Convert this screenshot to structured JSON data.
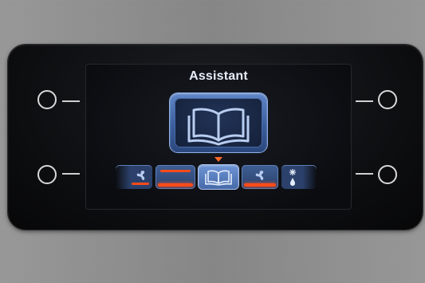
{
  "display": {
    "title": "Assistant",
    "selected_mode_icon": "open-book-icon",
    "accent_color": "#ff4b1a",
    "tile_color": "#3b5e9e"
  },
  "mode_strip": [
    {
      "icon": "fan-icon",
      "heat_bar": true
    },
    {
      "icon": "heating-bar-icon",
      "heat_bar": true
    },
    {
      "icon": "open-book-icon",
      "selected": true
    },
    {
      "icon": "fan-icon",
      "heat_bar": true
    },
    {
      "icon": "defrost-icon",
      "heat_bar": false
    }
  ],
  "controls": {
    "knobs": [
      "left-top-knob",
      "left-bottom-knob",
      "right-top-knob",
      "right-bottom-knob"
    ]
  }
}
